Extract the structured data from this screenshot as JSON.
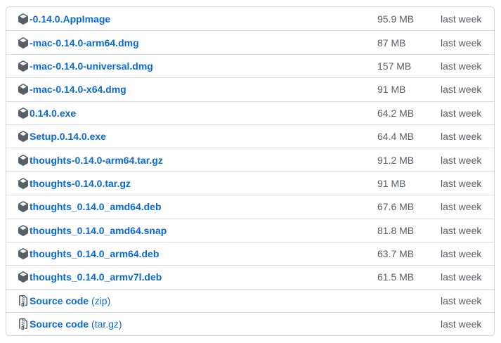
{
  "assets": [
    {
      "name": "-0.14.0.AppImage",
      "size": "95.9 MB",
      "date": "last week",
      "icon": "package-icon"
    },
    {
      "name": "-mac-0.14.0-arm64.dmg",
      "size": "87 MB",
      "date": "last week",
      "icon": "package-icon"
    },
    {
      "name": "-mac-0.14.0-universal.dmg",
      "size": "157 MB",
      "date": "last week",
      "icon": "package-icon"
    },
    {
      "name": "-mac-0.14.0-x64.dmg",
      "size": "91 MB",
      "date": "last week",
      "icon": "package-icon"
    },
    {
      "name": "0.14.0.exe",
      "size": "64.2 MB",
      "date": "last week",
      "icon": "package-icon"
    },
    {
      "name": "Setup.0.14.0.exe",
      "size": "64.4 MB",
      "date": "last week",
      "icon": "package-icon"
    },
    {
      "name": "thoughts-0.14.0-arm64.tar.gz",
      "size": "91.2 MB",
      "date": "last week",
      "icon": "package-icon"
    },
    {
      "name": "thoughts-0.14.0.tar.gz",
      "size": "91 MB",
      "date": "last week",
      "icon": "package-icon"
    },
    {
      "name": "thoughts_0.14.0_amd64.deb",
      "size": "67.6 MB",
      "date": "last week",
      "icon": "package-icon"
    },
    {
      "name": "thoughts_0.14.0_amd64.snap",
      "size": "81.8 MB",
      "date": "last week",
      "icon": "package-icon"
    },
    {
      "name": "thoughts_0.14.0_arm64.deb",
      "size": "63.7 MB",
      "date": "last week",
      "icon": "package-icon"
    },
    {
      "name": "thoughts_0.14.0_armv7l.deb",
      "size": "61.5 MB",
      "date": "last week",
      "icon": "package-icon"
    },
    {
      "name": "Source code",
      "suffix": "(zip)",
      "size": "",
      "date": "last week",
      "icon": "file-zip-icon"
    },
    {
      "name": "Source code",
      "suffix": "(tar.gz)",
      "size": "",
      "date": "last week",
      "icon": "file-zip-icon"
    }
  ],
  "colors": {
    "link": "#0969da",
    "muted": "#57606a",
    "border": "#d0d7de"
  }
}
